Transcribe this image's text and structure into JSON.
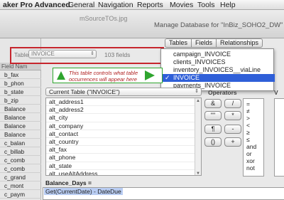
{
  "menubar": {
    "app_name": "aker Pro Advanced",
    "items": [
      "General",
      "Navigation",
      "Reports",
      "Movies",
      "Tools",
      "Help"
    ]
  },
  "window": {
    "doc_title": "mSourceTOs.jpg",
    "dialog_title": "Manage Database for \"InBiz_SOHO2_DW\""
  },
  "sidebar": {
    "header": "Field Nam",
    "rows": [
      "b_fax",
      "b_phon",
      "b_state",
      "b_zip",
      "Balance",
      "Balance",
      "Balance",
      "Balance",
      "c_balan",
      "c_billab",
      "c_comb",
      "c_comb",
      "c_grand",
      "c_mont",
      "c_paym"
    ]
  },
  "tabs": [
    "Tables",
    "Fields",
    "Relationships"
  ],
  "table_selector": {
    "label": "Table:",
    "value": "INVOICE",
    "field_count": "103 fields"
  },
  "popup": {
    "items": [
      "campaign_INVOICE",
      "clients_INVOICES",
      "inventory_INVOICES__viaLine",
      "INVOICE",
      "payments_INVOICE"
    ],
    "selected": "INVOICE",
    "check_glyph": "✓"
  },
  "callout": {
    "text": "This table controls what table occurrences will appear here",
    "color": "#2fa52f"
  },
  "current_table": "Current Table (\"INVOICE\")",
  "fields": [
    "alt_address1",
    "alt_address2",
    "alt_city",
    "alt_company",
    "alt_contact",
    "alt_country",
    "alt_fax",
    "alt_phone",
    "alt_state",
    "alt_useAltAddress"
  ],
  "operators": {
    "label": "Operators",
    "buttons": [
      "&",
      "/",
      "\"\"",
      "*",
      "¶",
      "-",
      "()",
      "+"
    ],
    "list": [
      "=",
      "≠",
      ">",
      "<",
      "≥",
      "≤",
      "and",
      "or",
      "xor",
      "not"
    ]
  },
  "right_edge_label": "V",
  "calculation": {
    "name": "Balance_Days =",
    "formula": "Get(CurrentDate) - DateDue"
  },
  "colors": {
    "highlight": "#c6262d",
    "selection": "#2f5fd8",
    "arrow": "#2fa52f"
  }
}
